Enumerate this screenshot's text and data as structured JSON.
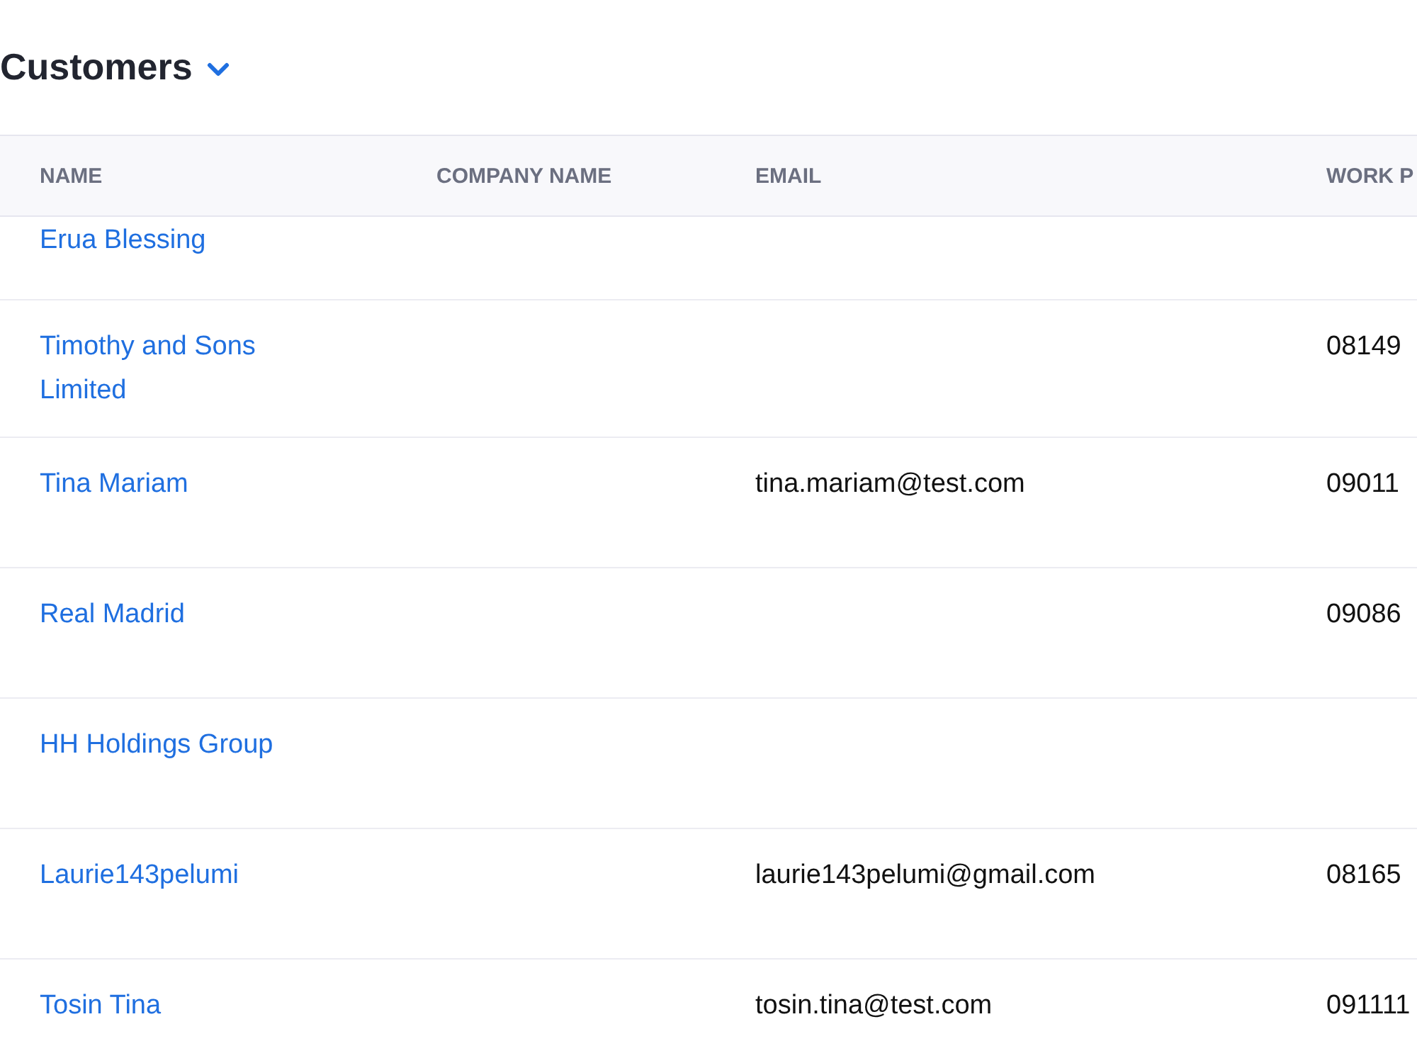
{
  "title": "Customers",
  "table": {
    "columns": [
      "NAME",
      "COMPANY NAME",
      "EMAIL",
      "WORK P"
    ],
    "rows": [
      {
        "name": "Erua Blessing"
      },
      {
        "name": "Timothy and Sons Limited",
        "work_phone": "08149"
      },
      {
        "name": "Tina Mariam",
        "email": "tina.mariam@test.com",
        "work_phone": "09011"
      },
      {
        "name": "Real Madrid",
        "work_phone": "09086"
      },
      {
        "name": "HH Holdings Group"
      },
      {
        "name": "Laurie143pelumi",
        "email": "laurie143pelumi@gmail.com",
        "work_phone": "08165"
      },
      {
        "name": "Tosin Tina",
        "email": "tosin.tina@test.com",
        "work_phone": "091111"
      }
    ]
  }
}
